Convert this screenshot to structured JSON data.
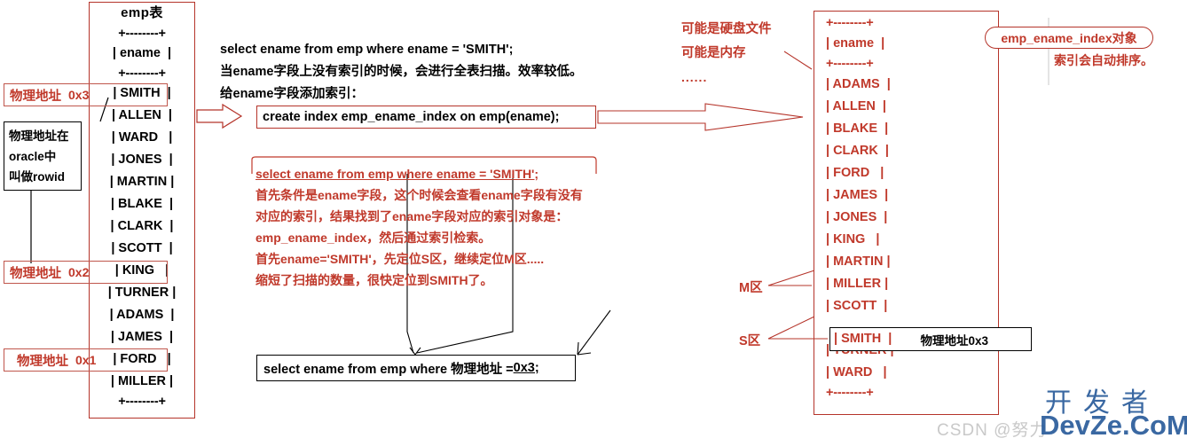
{
  "emp_table": {
    "title": "emp表",
    "rule": "+--------+",
    "header": "| ename  |",
    "rows": [
      "| SMITH  |",
      "| ALLEN  |",
      "| WARD   |",
      "| JONES  |",
      "| MARTIN |",
      "| BLAKE  |",
      "| CLARK  |",
      "| SCOTT  |",
      "| KING   |",
      "| TURNER |",
      "| ADAMS  |",
      "| JAMES  |",
      "| FORD   |",
      "| MILLER |"
    ]
  },
  "address_labels": [
    {
      "label": "物理地址",
      "hex": "0x3"
    },
    {
      "label": "物理地址",
      "hex": "0x2"
    },
    {
      "label": "物理地址",
      "hex": "0x1"
    }
  ],
  "rowid_note": {
    "line1": "物理地址在",
    "line2": "oracle中",
    "line3": "叫做rowid"
  },
  "center": {
    "line1": "select ename from emp where ename = 'SMITH';",
    "line2": "当ename字段上没有索引的时候，会进行全表扫描。效率较低。",
    "line3": "给ename字段添加索引：",
    "create_index": "create index emp_ename_index on emp(ename);"
  },
  "red_explanation": {
    "sql": "select ename from emp where ename = 'SMITH';",
    "line1": "首先条件是ename字段，这个时候会查看ename字段有没有",
    "line2": "对应的索引，结果找到了ename字段对应的索引对象是：",
    "line3": "emp_ename_index，然后通过索引检索。",
    "line4": "首先ename='SMITH'，先定位S区，继续定位M区.....",
    "line5": "缩短了扫描的数量，很快定位到SMITH了。"
  },
  "bottom_sql": {
    "prefix": "select ename from emp where 物理地址 = ",
    "value": "0x3;"
  },
  "maybe_notes": {
    "line1": "可能是硬盘文件",
    "line2": "可能是内存",
    "line3": "......"
  },
  "index_table": {
    "rule": "+--------+",
    "header": "| ename  |",
    "rows": [
      "| ADAMS  |",
      "| ALLEN  |",
      "| BLAKE  |",
      "| CLARK  |",
      "| FORD   |",
      "| JAMES  |",
      "| JONES  |",
      "| KING   |",
      "| MARTIN |",
      "| MILLER |",
      "| SCOTT  |",
      "| SMITH  |",
      "| TURNER |",
      "| WARD   |"
    ]
  },
  "zones": {
    "m_zone": "M区",
    "s_zone": "S区"
  },
  "smith_callout": "物理地址0x3",
  "index_object": {
    "name": "emp_ename_index对象",
    "note": "索引会自动排序。"
  },
  "watermark": {
    "csdn": "CSDN @努力",
    "dev_top": "开发者",
    "dev_bottom": "DevZe.CoM"
  },
  "colors": {
    "red": "#c0392b",
    "border_red": "#b5342a",
    "black": "#000000",
    "watermark_blue": "#2a5c9b",
    "watermark_gray": "#c9c9c9"
  }
}
